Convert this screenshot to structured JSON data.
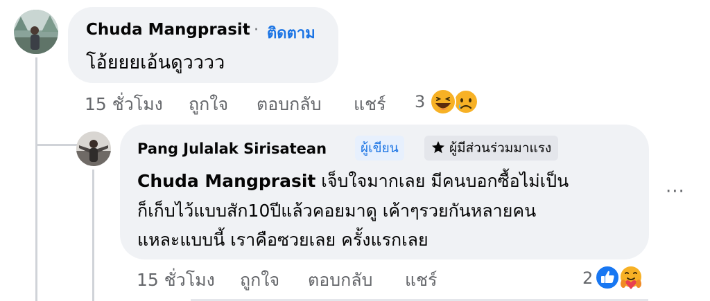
{
  "comment1": {
    "author": "Chuda Mangprasit",
    "separator": "·",
    "follow_label": "ติดตาม",
    "text": "โอ้ยยยเอ้นดูวววว",
    "actions": {
      "time": "15 ชั่วโมง",
      "like": "ถูกใจ",
      "reply": "ตอบกลับ",
      "share": "แชร์"
    },
    "reaction_count": "3",
    "reactions": [
      "haha-icon",
      "sad-icon"
    ]
  },
  "comment2": {
    "author": "Pang Julalak Sirisatean",
    "author_badge": "ผู้เขียน",
    "top_badge": "ผู้มีส่วนร่วมมาแรง",
    "mention": "Chuda Mangprasit",
    "text_line1": " เจ็บใจมากเลย มีคนบอกซื้อไม่เป็น",
    "text_line2": "ก็เก็บไว้แบบสัก10ปีแล้วคอยมาดู เค้าๆรวยกันหลายคน",
    "text_line3": "แหละแบบนี้ เราคือซวยเลย ครั้งแรกเลย",
    "actions": {
      "time": "15 ชั่วโมง",
      "like": "ถูกใจ",
      "reply": "ตอบกลับ",
      "share": "แชร์"
    },
    "reaction_count": "2",
    "reactions": [
      "like-icon",
      "care-icon"
    ],
    "more_label": "···"
  },
  "colors": {
    "bubble": "#f0f2f5",
    "link": "#1b74e4",
    "secondary_text": "#65676b",
    "like_blue": "#1877f2",
    "emoji_yellow": "#f7b125"
  }
}
